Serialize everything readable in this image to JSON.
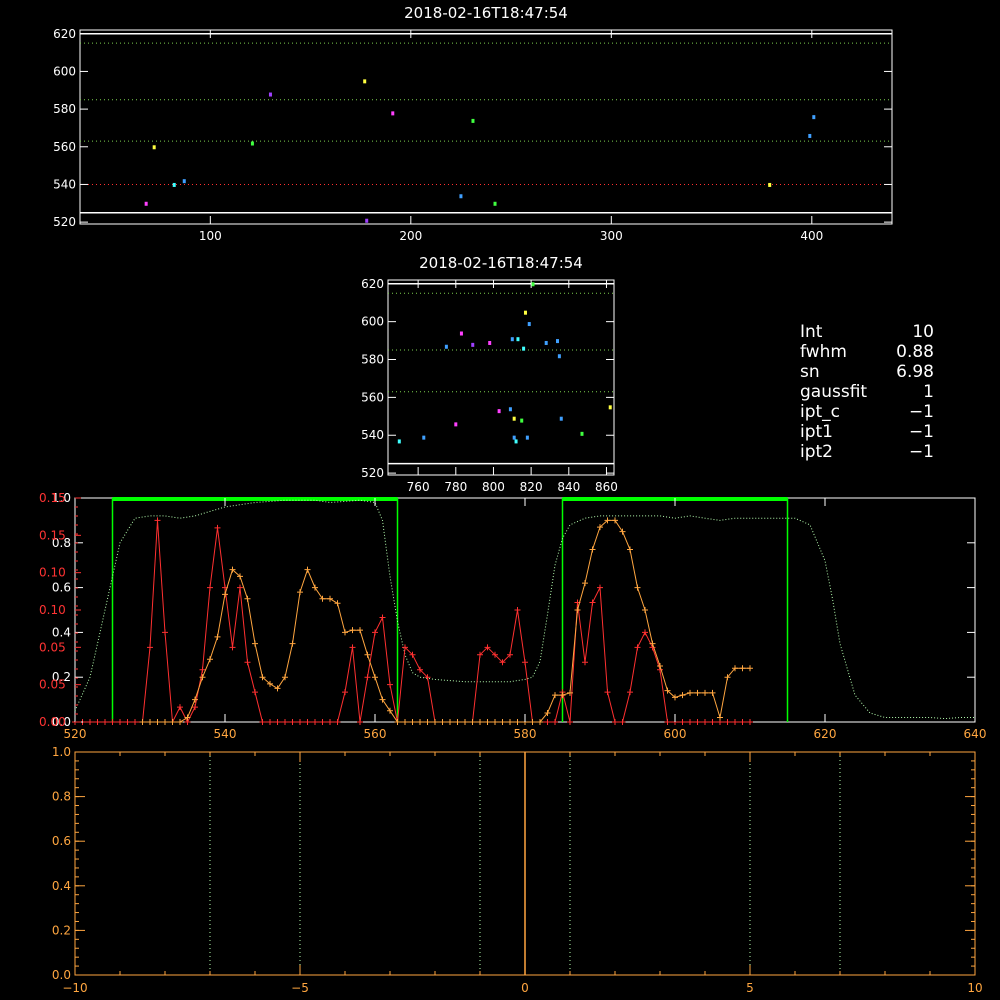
{
  "colors": {
    "background": "#000000",
    "axis_white": "#ffffff",
    "axis_red": "#ff3333",
    "axis_orange": "#ffa640",
    "green": "#00ff00",
    "green_dots": "#7ccf4f",
    "red_dots": "#ff3030",
    "light_green": "#b6ffb0",
    "marker_palette": [
      "#40a0ff",
      "#ff40ff",
      "#40ffff",
      "#ffff40",
      "#40ff40",
      "#a040ff"
    ]
  },
  "info_panel": {
    "rows": [
      {
        "key": "Int",
        "value": "10"
      },
      {
        "key": "fwhm",
        "value": "0.88"
      },
      {
        "key": "sn",
        "value": "6.98"
      },
      {
        "key": "gaussfit",
        "value": "1"
      },
      {
        "key": "ipt_c",
        "value": "−1"
      },
      {
        "key": "ipt1",
        "value": "−1"
      },
      {
        "key": "ipt2",
        "value": "−1"
      }
    ]
  },
  "chart_data": [
    {
      "id": "top",
      "type": "scatter",
      "title": "2018-02-16T18:47:54",
      "xlim": [
        35,
        440
      ],
      "ylim": [
        519,
        622
      ],
      "xticks": [
        100,
        200,
        300,
        400
      ],
      "yticks": [
        520,
        540,
        560,
        580,
        600,
        620
      ],
      "hlines": [
        {
          "y": 620,
          "style": "solid",
          "color": "#ffffff"
        },
        {
          "y": 615,
          "style": "dotted",
          "color": "#7ccf4f"
        },
        {
          "y": 585,
          "style": "dotted",
          "color": "#7ccf4f"
        },
        {
          "y": 563,
          "style": "dotted",
          "color": "#7ccf4f"
        },
        {
          "y": 540,
          "style": "dotted",
          "color": "#ff3030"
        },
        {
          "y": 525,
          "style": "solid",
          "color": "#ffffff"
        }
      ],
      "points": [
        {
          "x": 68,
          "y": 530,
          "c": 1
        },
        {
          "x": 72,
          "y": 560,
          "c": 3
        },
        {
          "x": 82,
          "y": 540,
          "c": 2
        },
        {
          "x": 87,
          "y": 542,
          "c": 0
        },
        {
          "x": 121,
          "y": 562,
          "c": 4
        },
        {
          "x": 130,
          "y": 588,
          "c": 5
        },
        {
          "x": 177,
          "y": 595,
          "c": 3
        },
        {
          "x": 178,
          "y": 521,
          "c": 5
        },
        {
          "x": 191,
          "y": 578,
          "c": 1
        },
        {
          "x": 225,
          "y": 534,
          "c": 0
        },
        {
          "x": 231,
          "y": 574,
          "c": 4
        },
        {
          "x": 242,
          "y": 530,
          "c": 4
        },
        {
          "x": 379,
          "y": 540,
          "c": 3
        },
        {
          "x": 399,
          "y": 566,
          "c": 0
        },
        {
          "x": 401,
          "y": 576,
          "c": 0
        }
      ]
    },
    {
      "id": "mid",
      "type": "scatter",
      "title": "2018-02-16T18:47:54",
      "xlim": [
        744,
        864
      ],
      "ylim": [
        519,
        622
      ],
      "xticks": [
        760,
        780,
        800,
        820,
        840,
        860
      ],
      "yticks": [
        520,
        540,
        560,
        580,
        600,
        620
      ],
      "hlines": [
        {
          "y": 620,
          "style": "solid",
          "color": "#ffffff"
        },
        {
          "y": 615,
          "style": "dotted",
          "color": "#7ccf4f"
        },
        {
          "y": 585,
          "style": "dotted",
          "color": "#7ccf4f"
        },
        {
          "y": 563,
          "style": "dotted",
          "color": "#7ccf4f"
        },
        {
          "y": 525,
          "style": "solid",
          "color": "#ffffff"
        }
      ],
      "points": [
        {
          "x": 750,
          "y": 537,
          "c": 2
        },
        {
          "x": 763,
          "y": 539,
          "c": 0
        },
        {
          "x": 775,
          "y": 587,
          "c": 0
        },
        {
          "x": 780,
          "y": 546,
          "c": 1
        },
        {
          "x": 783,
          "y": 594,
          "c": 1
        },
        {
          "x": 789,
          "y": 588,
          "c": 5
        },
        {
          "x": 798,
          "y": 589,
          "c": 1
        },
        {
          "x": 803,
          "y": 553,
          "c": 1
        },
        {
          "x": 809,
          "y": 554,
          "c": 0
        },
        {
          "x": 810,
          "y": 591,
          "c": 0
        },
        {
          "x": 811,
          "y": 549,
          "c": 3
        },
        {
          "x": 811,
          "y": 539,
          "c": 0
        },
        {
          "x": 812,
          "y": 537,
          "c": 2
        },
        {
          "x": 813,
          "y": 591,
          "c": 2
        },
        {
          "x": 815,
          "y": 548,
          "c": 4
        },
        {
          "x": 816,
          "y": 586,
          "c": 2
        },
        {
          "x": 817,
          "y": 605,
          "c": 3
        },
        {
          "x": 818,
          "y": 539,
          "c": 0
        },
        {
          "x": 819,
          "y": 599,
          "c": 0
        },
        {
          "x": 821,
          "y": 620,
          "c": 4
        },
        {
          "x": 828,
          "y": 589,
          "c": 0
        },
        {
          "x": 834,
          "y": 590,
          "c": 0
        },
        {
          "x": 835,
          "y": 582,
          "c": 0
        },
        {
          "x": 836,
          "y": 549,
          "c": 0
        },
        {
          "x": 847,
          "y": 541,
          "c": 4
        },
        {
          "x": 862,
          "y": 555,
          "c": 3
        }
      ]
    },
    {
      "id": "spectrum",
      "type": "line",
      "xlim": [
        520,
        640
      ],
      "xticks": [
        520,
        540,
        560,
        580,
        600,
        620,
        640
      ],
      "y_left_white_ticks": [
        "0.0",
        "0.2",
        "0.4",
        "0.6",
        "0.8",
        "1.0"
      ],
      "y_left_red_ticks": [
        "0.00",
        "0.05",
        "0.05",
        "0.10",
        "0.10",
        "0.15",
        "0.15"
      ],
      "bands": [
        [
          525,
          563
        ],
        [
          585,
          615
        ]
      ],
      "filter_curve": {
        "x": [
          520,
          522,
          524,
          526,
          528,
          530,
          532,
          534,
          536,
          538,
          540,
          542,
          544,
          546,
          548,
          550,
          552,
          554,
          556,
          558,
          560,
          561,
          562,
          563,
          564,
          565,
          566,
          568,
          570,
          572,
          574,
          576,
          578,
          580,
          581,
          582,
          583,
          584,
          585,
          586,
          588,
          590,
          592,
          594,
          596,
          598,
          600,
          602,
          604,
          606,
          608,
          610,
          612,
          614,
          616,
          618,
          620,
          621,
          622,
          624,
          626,
          628,
          630,
          632,
          634,
          636,
          638,
          640
        ],
        "y": [
          0.05,
          0.2,
          0.5,
          0.8,
          0.91,
          0.92,
          0.92,
          0.91,
          0.92,
          0.94,
          0.96,
          0.97,
          0.98,
          0.985,
          0.99,
          0.99,
          0.99,
          0.98,
          0.985,
          0.99,
          0.98,
          0.9,
          0.65,
          0.45,
          0.3,
          0.22,
          0.2,
          0.19,
          0.185,
          0.18,
          0.18,
          0.18,
          0.18,
          0.19,
          0.2,
          0.27,
          0.48,
          0.7,
          0.82,
          0.88,
          0.91,
          0.92,
          0.92,
          0.92,
          0.92,
          0.92,
          0.91,
          0.92,
          0.91,
          0.9,
          0.91,
          0.91,
          0.91,
          0.91,
          0.91,
          0.88,
          0.72,
          0.55,
          0.35,
          0.12,
          0.04,
          0.02,
          0.02,
          0.02,
          0.02,
          0.015,
          0.02,
          0.02
        ]
      },
      "red_series": {
        "x": [
          520,
          521,
          522,
          523,
          524,
          525,
          526,
          527,
          528,
          529,
          530,
          531,
          532,
          533,
          534,
          535,
          536,
          537,
          538,
          539,
          540,
          541,
          542,
          543,
          544,
          545,
          546,
          547,
          548,
          549,
          550,
          551,
          552,
          553,
          554,
          555,
          556,
          557,
          558,
          559,
          560,
          561,
          562,
          563,
          564,
          565,
          566,
          567,
          568,
          569,
          570,
          571,
          572,
          573,
          574,
          575,
          576,
          577,
          578,
          579,
          580,
          581,
          582,
          583,
          584,
          585,
          586,
          587,
          588,
          589,
          590,
          591,
          592,
          593,
          594,
          595,
          596,
          597,
          598,
          599,
          600,
          601,
          602,
          603,
          604,
          605,
          606,
          607,
          608,
          609,
          610
        ],
        "y": [
          0,
          0,
          0,
          0,
          0,
          0,
          0,
          0,
          0,
          0,
          0.05,
          0.135,
          0.06,
          0,
          0.01,
          0,
          0.01,
          0.035,
          0.09,
          0.13,
          0.09,
          0.05,
          0.09,
          0.04,
          0.02,
          0,
          0,
          0,
          0,
          0,
          0,
          0,
          0,
          0,
          0,
          0,
          0.02,
          0.05,
          0,
          0.03,
          0.06,
          0.07,
          0.025,
          0,
          0.05,
          0.045,
          0.035,
          0.03,
          0,
          0,
          0,
          0,
          0,
          0,
          0.045,
          0.05,
          0.045,
          0.04,
          0.045,
          0.075,
          0.04,
          0,
          0,
          0,
          0,
          0.02,
          0,
          0.08,
          0.04,
          0.08,
          0.09,
          0.02,
          0,
          0,
          0.02,
          0.05,
          0.06,
          0.05,
          0.035,
          0,
          0,
          0,
          0,
          0,
          0,
          0,
          0,
          0,
          0,
          0,
          0
        ]
      },
      "orange_series": {
        "x": [
          529,
          530,
          531,
          532,
          533,
          534,
          535,
          536,
          537,
          538,
          539,
          540,
          541,
          542,
          543,
          544,
          545,
          546,
          547,
          548,
          549,
          550,
          551,
          552,
          553,
          554,
          555,
          556,
          557,
          558,
          559,
          560,
          561,
          562,
          563,
          564,
          565,
          566,
          567,
          568,
          569,
          570,
          571,
          572,
          573,
          574,
          575,
          576,
          577,
          578,
          579,
          580,
          581,
          582,
          583,
          584,
          585,
          586,
          587,
          588,
          589,
          590,
          591,
          592,
          593,
          594,
          595,
          596,
          597,
          598,
          599,
          600,
          601,
          602,
          603,
          604,
          605,
          606,
          607,
          608,
          609,
          610
        ],
        "y": [
          0,
          0,
          0,
          0,
          0,
          0,
          0.02,
          0.1,
          0.2,
          0.28,
          0.38,
          0.57,
          0.68,
          0.65,
          0.55,
          0.35,
          0.2,
          0.17,
          0.15,
          0.2,
          0.35,
          0.58,
          0.68,
          0.6,
          0.55,
          0.55,
          0.53,
          0.4,
          0.41,
          0.41,
          0.3,
          0.2,
          0.1,
          0.05,
          0,
          0,
          0,
          0,
          0,
          0,
          0,
          0,
          0,
          0,
          0,
          0,
          0,
          0,
          0,
          0,
          0,
          0,
          0,
          0,
          0.04,
          0.12,
          0.12,
          0.13,
          0.5,
          0.62,
          0.77,
          0.87,
          0.9,
          0.9,
          0.85,
          0.77,
          0.6,
          0.5,
          0.35,
          0.25,
          0.14,
          0.11,
          0.12,
          0.13,
          0.13,
          0.13,
          0.13,
          0.02,
          0.2,
          0.24,
          0.24,
          0.24,
          0.24,
          0.24,
          0,
          0
        ]
      }
    },
    {
      "id": "bottom",
      "type": "line",
      "xlim": [
        -10,
        10
      ],
      "ylim": [
        0,
        1
      ],
      "xticks": [
        "−10",
        "−5",
        "0",
        "5",
        "10"
      ],
      "xtick_values": [
        -10,
        -5,
        0,
        5,
        10
      ],
      "yticks": [
        "0.0",
        "0.2",
        "0.4",
        "0.6",
        "0.8",
        "1.0"
      ],
      "ytick_values": [
        0,
        0.2,
        0.4,
        0.6,
        0.8,
        1.0
      ],
      "vlines": [
        {
          "x": -7,
          "style": "dotted",
          "color": "#b6ffb0"
        },
        {
          "x": -5,
          "style": "dotted",
          "color": "#b6ffb0"
        },
        {
          "x": -1,
          "style": "dotted",
          "color": "#b6ffb0"
        },
        {
          "x": 0,
          "style": "solid",
          "color": "#ffa640"
        },
        {
          "x": 1,
          "style": "dotted",
          "color": "#b6ffb0"
        },
        {
          "x": 5,
          "style": "dotted",
          "color": "#b6ffb0"
        },
        {
          "x": 7,
          "style": "dotted",
          "color": "#b6ffb0"
        }
      ]
    }
  ]
}
